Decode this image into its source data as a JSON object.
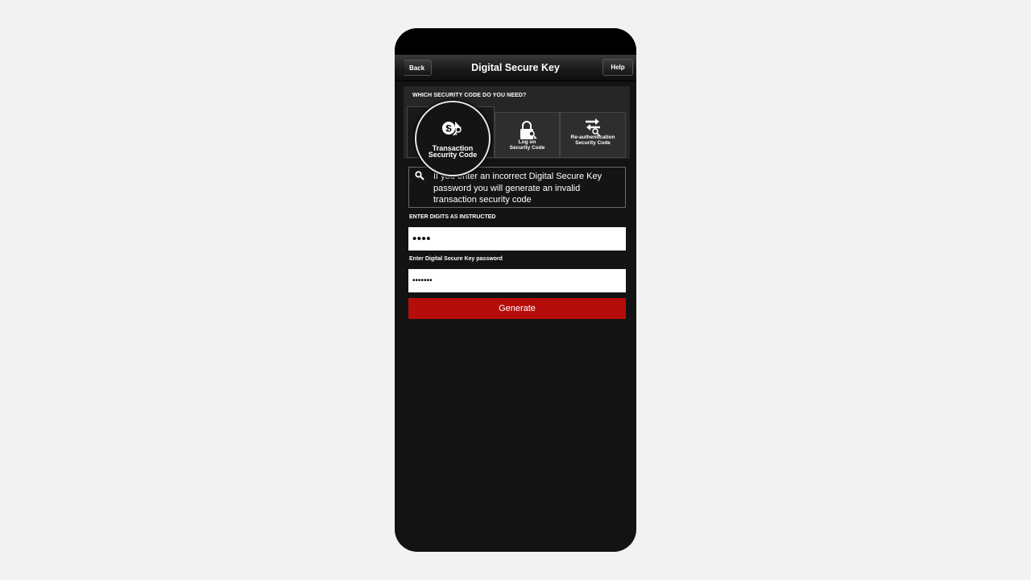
{
  "nav": {
    "title": "Digital Secure Key",
    "back_label": "Back",
    "help_label": "Help"
  },
  "security_section": {
    "header": "WHICH SECURITY CODE DO YOU NEED?",
    "options": [
      {
        "line1": "Transaction",
        "line2": "Security Code",
        "icon": "dollar-key-icon",
        "selected": true
      },
      {
        "line1": "Log on",
        "line2": "Security Code",
        "icon": "padlock-key-icon",
        "selected": false
      },
      {
        "line1": "Re-authentication",
        "line2": "Security Code",
        "icon": "arrows-key-icon",
        "selected": false
      }
    ]
  },
  "info": {
    "icon": "magnifier-icon",
    "text": "If you enter an incorrect Digital Secure Key password you will generate an invalid transaction security code"
  },
  "digits": {
    "label": "ENTER DIGITS AS INSTRUCTED",
    "value": "••••"
  },
  "password": {
    "label": "Enter Digital Secure Key password",
    "value": "•••••••"
  },
  "generate_label": "Generate",
  "colors": {
    "accent_red": "#b50e0a",
    "background": "#131313"
  }
}
